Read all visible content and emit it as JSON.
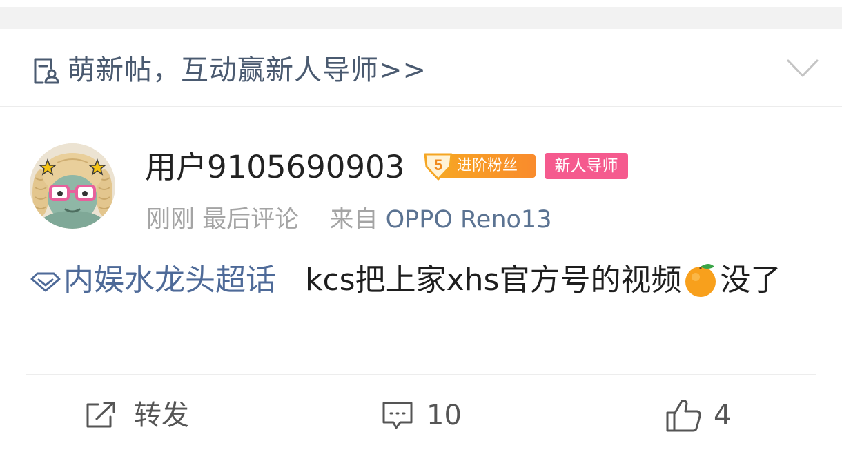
{
  "banner": {
    "text": "萌新帖，互动赢新人导师>>",
    "icon": "newbie-post-icon",
    "chevron_icon": "chevron-down-icon"
  },
  "post": {
    "author": {
      "name": "用户9105690903",
      "avatar": "cartoon-avatar",
      "fan_badge": {
        "level": "5",
        "label": "进阶粉丝",
        "color": "#f7a623"
      },
      "mentor_badge": {
        "label": "新人导师",
        "color": "#f55a8e"
      }
    },
    "meta": {
      "time": "刚刚",
      "activity": "最后评论",
      "from_label": "来自",
      "device": "OPPO Reno13"
    },
    "content": {
      "topic": "内娱水龙头超话",
      "text_before_emoji": "kcs把上家xhs官方号的视频",
      "emoji": "orange-emoji",
      "text_after_emoji": "没了"
    }
  },
  "actions": {
    "repost_label": "转发",
    "comment_count": "10",
    "like_count": "4"
  },
  "colors": {
    "link": "#5b7392",
    "topic": "#4e6a98",
    "banner_text": "#4a5a70"
  }
}
